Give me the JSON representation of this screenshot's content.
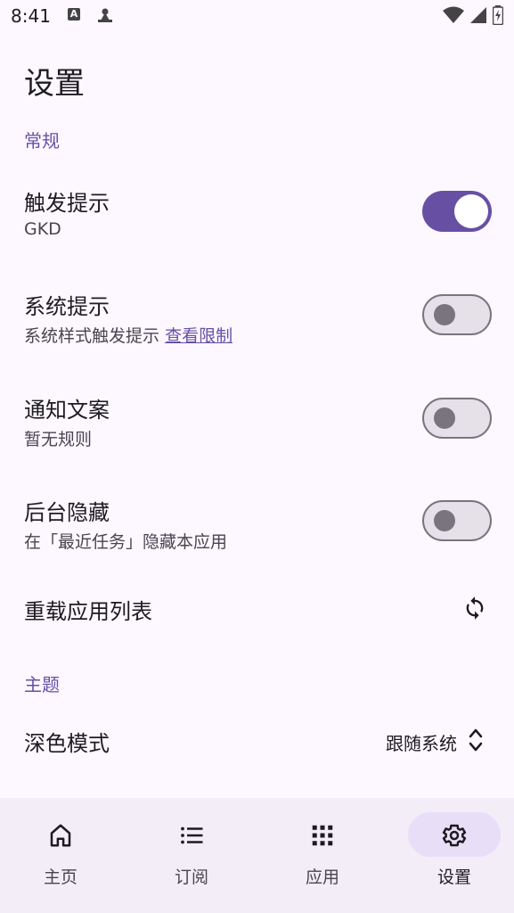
{
  "status": {
    "time": "8:41",
    "a_badge": "A"
  },
  "page": {
    "title": "设置"
  },
  "sections": {
    "general": "常规",
    "theme": "主题"
  },
  "settings": {
    "trigger_hint": {
      "title": "触发提示",
      "subtitle": "GKD",
      "enabled": true
    },
    "system_hint": {
      "title": "系统提示",
      "subtitle": "系统样式触发提示",
      "link": "查看限制",
      "enabled": false
    },
    "notify_text": {
      "title": "通知文案",
      "subtitle": "暂无规则",
      "enabled": false
    },
    "bg_hide": {
      "title": "后台隐藏",
      "subtitle": "在「最近任务」隐藏本应用",
      "enabled": false
    },
    "reload_apps": {
      "title": "重载应用列表"
    },
    "dark_mode": {
      "title": "深色模式",
      "value": "跟随系统"
    }
  },
  "nav": {
    "items": [
      {
        "label": "主页",
        "icon": "home-icon",
        "active": false
      },
      {
        "label": "订阅",
        "icon": "list-icon",
        "active": false
      },
      {
        "label": "应用",
        "icon": "apps-grid-icon",
        "active": false
      },
      {
        "label": "设置",
        "icon": "gear-icon",
        "active": true
      }
    ]
  },
  "colors": {
    "accent": "#6750A4",
    "background": "#FDF7FF",
    "nav_bg": "#F3EDF7",
    "active_pill": "#E8DEF8"
  }
}
